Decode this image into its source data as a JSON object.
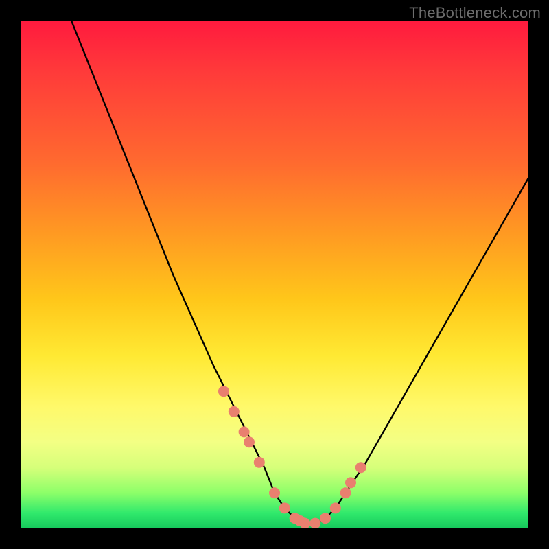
{
  "watermark": "TheBottleneck.com",
  "chart_data": {
    "type": "line",
    "title": "",
    "xlabel": "",
    "ylabel": "",
    "xlim": [
      0,
      100
    ],
    "ylim": [
      0,
      100
    ],
    "series": [
      {
        "name": "bottleneck-curve",
        "x": [
          10,
          14,
          18,
          22,
          26,
          30,
          34,
          38,
          42,
          45,
          48,
          50,
          52,
          54,
          56,
          58,
          60,
          62,
          64,
          68,
          72,
          76,
          80,
          84,
          88,
          92,
          96,
          100
        ],
        "values": [
          100,
          90,
          80,
          70,
          60,
          50,
          41,
          32,
          24,
          18,
          12,
          7,
          4,
          2,
          1,
          1,
          2,
          4,
          7,
          13,
          20,
          27,
          34,
          41,
          48,
          55,
          62,
          69
        ]
      }
    ],
    "markers": {
      "name": "highlight-points",
      "x": [
        40,
        42,
        44,
        45,
        47,
        50,
        52,
        54,
        55,
        56,
        58,
        60,
        62,
        64,
        65,
        67
      ],
      "values": [
        27,
        23,
        19,
        17,
        13,
        7,
        4,
        2,
        1.5,
        1,
        1,
        2,
        4,
        7,
        9,
        12
      ],
      "color": "#e9806f",
      "radius": 8
    },
    "gradient_stops": [
      {
        "pos": 0,
        "color": "#ff1a3e"
      },
      {
        "pos": 10,
        "color": "#ff3a3a"
      },
      {
        "pos": 28,
        "color": "#ff6a2f"
      },
      {
        "pos": 42,
        "color": "#ff9a22"
      },
      {
        "pos": 55,
        "color": "#ffc71a"
      },
      {
        "pos": 66,
        "color": "#ffe933"
      },
      {
        "pos": 76,
        "color": "#fff96a"
      },
      {
        "pos": 83,
        "color": "#f3ff84"
      },
      {
        "pos": 88,
        "color": "#d6ff7a"
      },
      {
        "pos": 93,
        "color": "#8dff69"
      },
      {
        "pos": 97,
        "color": "#30e96c"
      },
      {
        "pos": 100,
        "color": "#16c95c"
      }
    ]
  }
}
